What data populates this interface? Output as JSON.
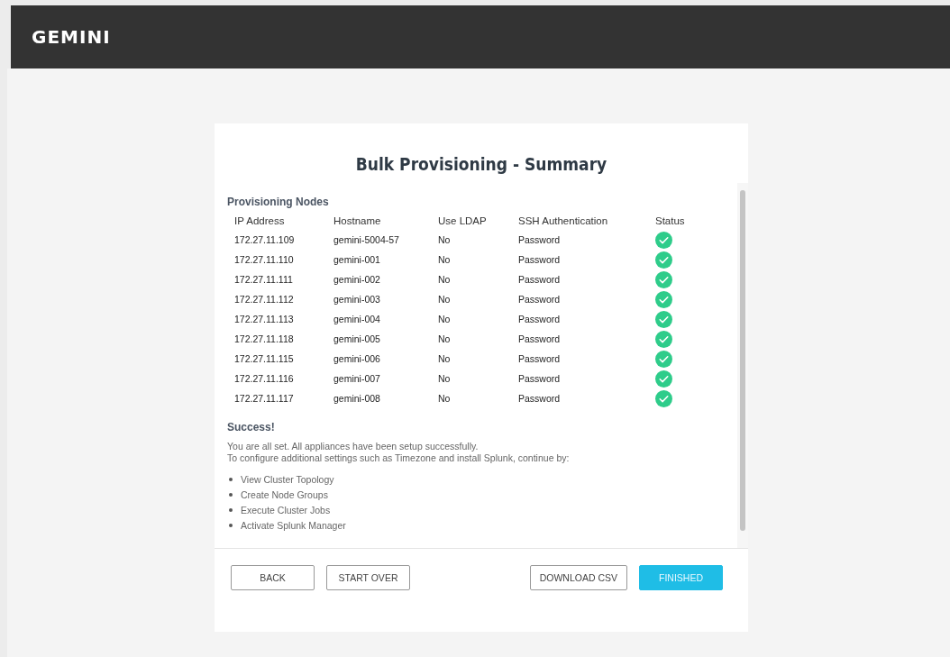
{
  "header": {
    "logo": "GEMINI"
  },
  "card": {
    "title": "Bulk Provisioning - Summary",
    "section_title": "Provisioning Nodes",
    "table": {
      "columns": [
        "IP Address",
        "Hostname",
        "Use LDAP",
        "SSH Authentication",
        "Status"
      ],
      "rows": [
        {
          "ip": "172.27.11.109",
          "hostname": "gemini-5004-57",
          "ldap": "No",
          "ssh": "Password",
          "kind": "success"
        },
        {
          "ip": "172.27.11.110",
          "hostname": "gemini-001",
          "ldap": "No",
          "ssh": "Password",
          "kind": "success"
        },
        {
          "ip": "172.27.11.111",
          "hostname": "gemini-002",
          "ldap": "No",
          "ssh": "Password",
          "kind": "success"
        },
        {
          "ip": "172.27.11.112",
          "hostname": "gemini-003",
          "ldap": "No",
          "ssh": "Password",
          "kind": "success"
        },
        {
          "ip": "172.27.11.113",
          "hostname": "gemini-004",
          "ldap": "No",
          "ssh": "Password",
          "kind": "success"
        },
        {
          "ip": "172.27.11.118",
          "hostname": "gemini-005",
          "ldap": "No",
          "ssh": "Password",
          "kind": "success"
        },
        {
          "ip": "172.27.11.115",
          "hostname": "gemini-006",
          "ldap": "No",
          "ssh": "Password",
          "kind": "success"
        },
        {
          "ip": "172.27.11.116",
          "hostname": "gemini-007",
          "ldap": "No",
          "ssh": "Password",
          "kind": "success"
        },
        {
          "ip": "172.27.11.117",
          "hostname": "gemini-008",
          "ldap": "No",
          "ssh": "Password",
          "kind": "success"
        }
      ]
    },
    "success_title": "Success!",
    "message_lines": [
      "You are all set. All appliances have been setup successfully.",
      "To configure additional settings such as Timezone and install Splunk, continue by:"
    ],
    "next_steps": [
      "View Cluster Topology",
      "Create Node Groups",
      "Execute Cluster Jobs",
      "Activate Splunk Manager"
    ],
    "buttons_left": [
      {
        "label": "BACK",
        "kind": "outline"
      },
      {
        "label": "START OVER",
        "kind": "outline"
      }
    ],
    "buttons_right": [
      {
        "label": "DOWNLOAD CSV",
        "kind": "outline"
      },
      {
        "label": "FINISHED",
        "kind": "primary"
      }
    ]
  }
}
